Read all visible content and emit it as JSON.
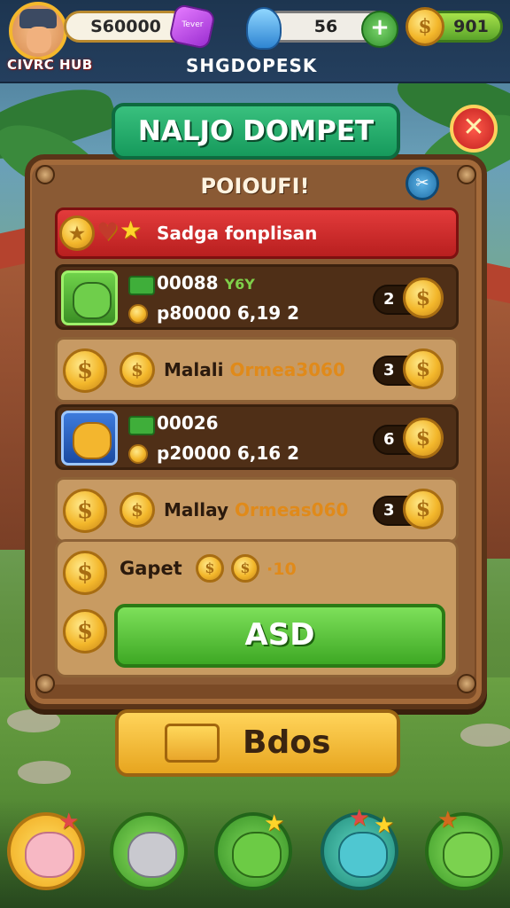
{
  "hud": {
    "brand": "CIVRC HUB",
    "money": "S60000",
    "gem_label": "Tever",
    "energy": "56",
    "plus": "+",
    "coins": "901",
    "screen_title": "SHGDOPESK"
  },
  "dialog": {
    "title": "NALJO DOMPET",
    "close": "✕",
    "heading": "POIOUFI!",
    "info": "✂",
    "alert": "Sadga fonplisan"
  },
  "rows": [
    {
      "line1": "00088",
      "line1_suffix": "Y6Y",
      "line2": "p80000 6,19 2",
      "count": "2",
      "style": "dark",
      "char": "green"
    },
    {
      "label_a": "Malali",
      "label_b": "Ormea3060",
      "count": "3",
      "style": "light"
    },
    {
      "line1": "00026",
      "line2": "p20000 6,16 2",
      "count": "6",
      "style": "dark",
      "char": "blue"
    },
    {
      "label_a": "Mallay",
      "label_b": "Ormeas060",
      "count": "3",
      "style": "light"
    }
  ],
  "gapet": {
    "label": "Gapet",
    "value": "·10"
  },
  "buttons": {
    "asd": "ASD",
    "bdos": "Bdos"
  },
  "nav": [
    "pig-pet",
    "koala-pet",
    "frog-pet",
    "fish-pet",
    "snail-pet"
  ],
  "colors": {
    "primary_green": "#3ea824",
    "panel_wood": "#7a4a26",
    "alert_red": "#d42e2e",
    "coin_gold": "#f3b72b"
  }
}
